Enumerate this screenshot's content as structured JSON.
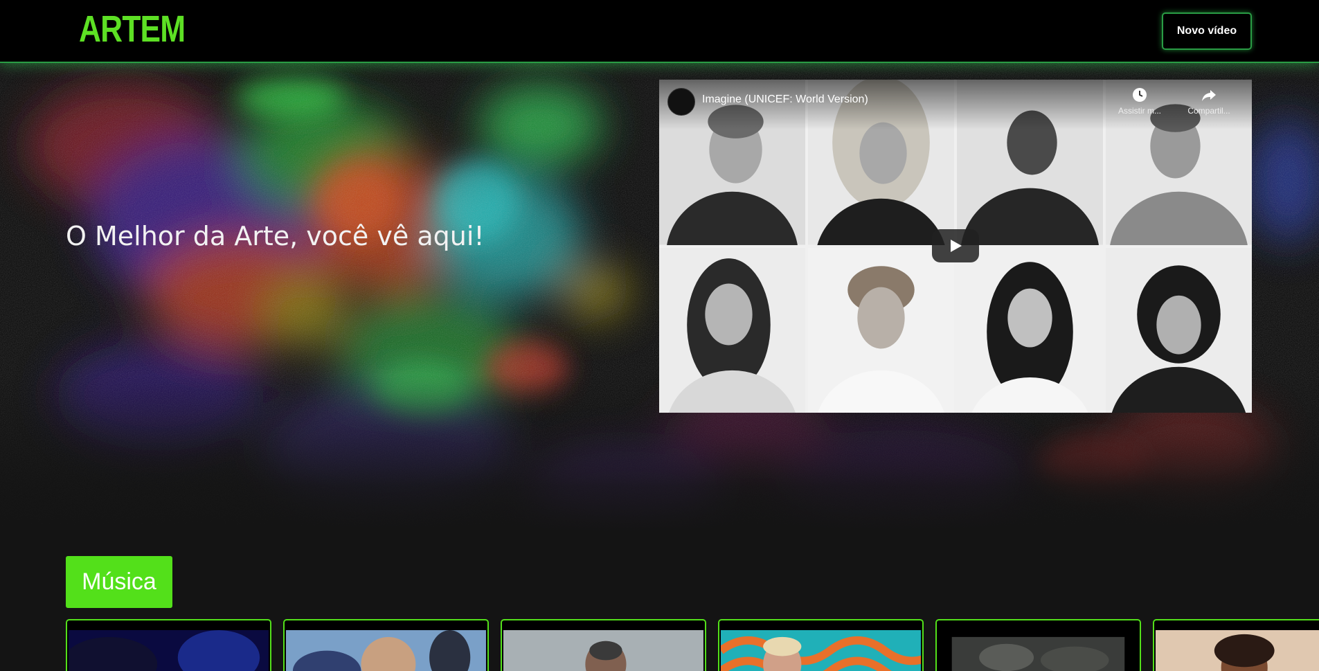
{
  "header": {
    "logo": "ARTEM",
    "new_video_label": "Novo vídeo"
  },
  "hero": {
    "title": "O Melhor da Arte, você vê aqui!"
  },
  "player": {
    "video_title": "Imagine (UNICEF: World Version)",
    "watch_later_label": "Assistir m...",
    "share_label": "Compartil..."
  },
  "category": {
    "label": "Música"
  },
  "colors": {
    "accent": "#53e01a",
    "header_border": "#2a9d45",
    "background": "#141414"
  },
  "icons": [
    "play-icon",
    "clock-icon",
    "share-icon",
    "channel-avatar"
  ]
}
